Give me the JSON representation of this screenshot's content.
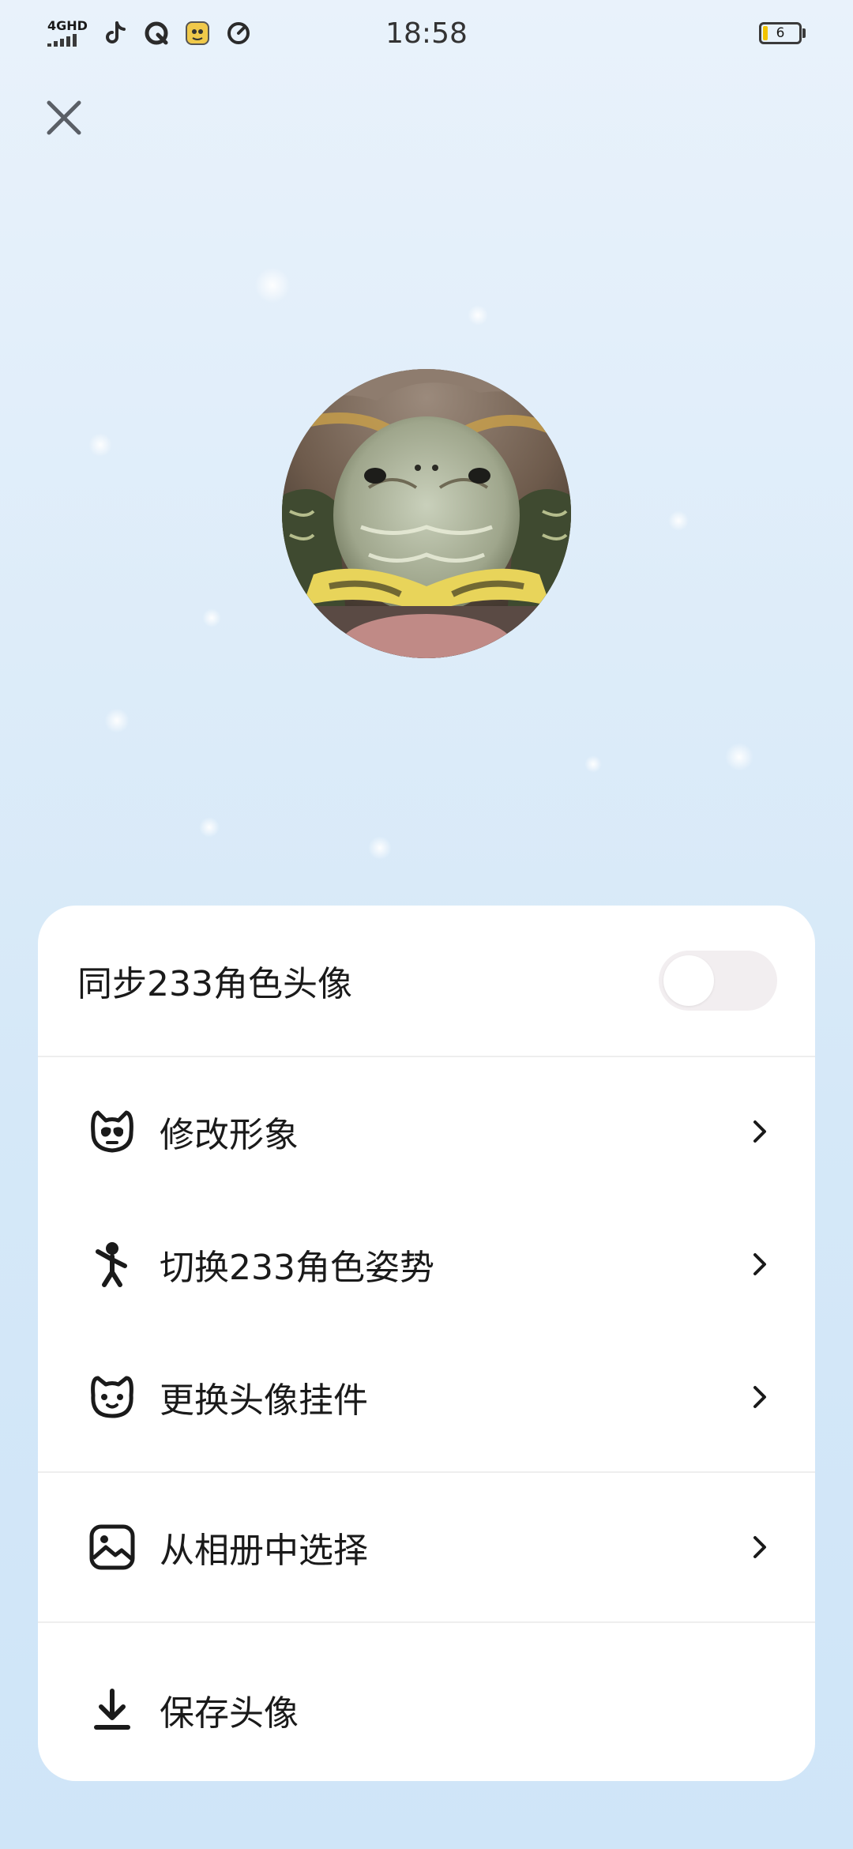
{
  "status_bar": {
    "network": "4GHD",
    "time": "18:58",
    "battery": "6",
    "icons": [
      "tiktok-icon",
      "q-app-icon",
      "game-app-icon",
      "speedometer-icon"
    ]
  },
  "close_icon": "close-icon",
  "avatar": {
    "description_icon": "turtle-avatar-image"
  },
  "sheet": {
    "sync": {
      "label": "同步233角色头像",
      "enabled": false
    },
    "menu": [
      {
        "label": "修改形象",
        "icon": "cat-face-icon"
      },
      {
        "label": "切换233角色姿势",
        "icon": "waving-figure-icon"
      },
      {
        "label": "更换头像挂件",
        "icon": "cat-head-icon"
      }
    ],
    "album": {
      "label": "从相册中选择",
      "icon": "gallery-icon"
    },
    "save": {
      "label": "保存头像",
      "icon": "download-icon"
    }
  },
  "colors": {
    "background": "#dcebf9",
    "sheet": "#ffffff",
    "text": "#1a1a1a",
    "toggle_off": "#f2eef0"
  }
}
